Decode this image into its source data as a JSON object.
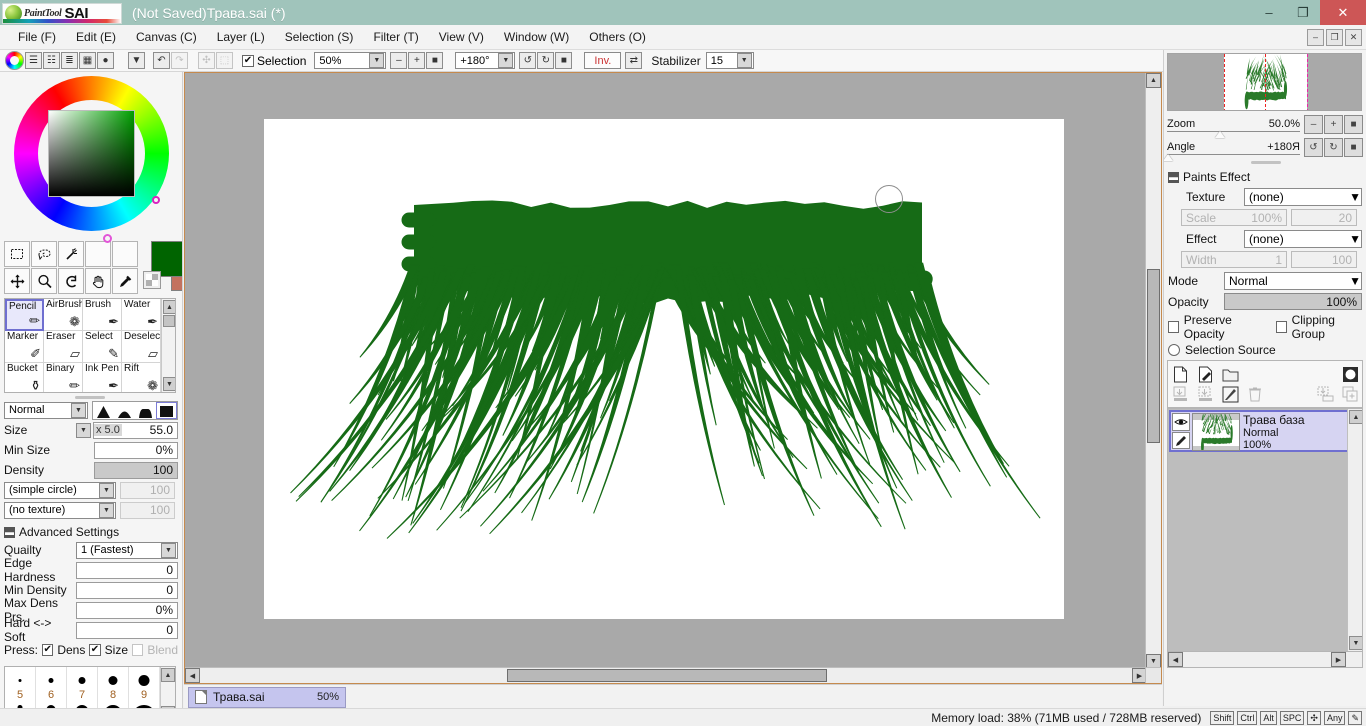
{
  "app": {
    "brand_paint_tool": "PaintTool",
    "brand_sai": "SAI",
    "title": "(Not Saved)Трава.sai (*)"
  },
  "window_controls": {
    "minimize": "–",
    "maximize": "❐",
    "close": "✕"
  },
  "menu": {
    "items": [
      {
        "label": "File (F)"
      },
      {
        "label": "Edit (E)"
      },
      {
        "label": "Canvas (C)"
      },
      {
        "label": "Layer (L)"
      },
      {
        "label": "Selection (S)"
      },
      {
        "label": "Filter (T)"
      },
      {
        "label": "View (V)"
      },
      {
        "label": "Window (W)"
      },
      {
        "label": "Others (O)"
      }
    ],
    "win_minimize": "–",
    "win_restore": "❐",
    "win_close": "✕"
  },
  "toolbar": {
    "palette_icons": [
      "color-wheel-icon",
      "rgb-slider-icon",
      "hsv-slider-icon",
      "color-list-icon",
      "swatches-icon",
      "gradient-icon"
    ],
    "more_arrow": "▼",
    "undo": "↶",
    "redo": "↷",
    "transform": "✣",
    "crop": "⬚",
    "selection_label": "Selection",
    "selection_checked": "✔",
    "zoom_value": "50%",
    "zoom_out": "–",
    "zoom_in": "+",
    "zoom_reset": "■",
    "angle_value": "+180°",
    "rotate_ccw": "↺",
    "rotate_cw": "↻",
    "rotate_reset": "■",
    "invert_label": "Inv.",
    "flip_label": "⇄",
    "stabilizer_label": "Stabilizer",
    "stabilizer_value": "15",
    "dropdown_arrow": "▼"
  },
  "left_panel": {
    "tool_icons_row1": [
      "rect-select-icon",
      "lasso-select-icon",
      "magic-wand-icon",
      "empty-slot-icon",
      "empty-slot-icon"
    ],
    "tool_icons_row2": [
      "move-icon",
      "zoom-icon",
      "rotate-icon",
      "hand-icon",
      "eyedropper-icon"
    ],
    "tool_glyphs_row1": [
      "⬚",
      "◖",
      "✳",
      "",
      ""
    ],
    "tool_glyphs_row2": [
      "✥",
      "⚲",
      "↺",
      "✋",
      "✒"
    ],
    "foreground_color": "#006400",
    "background_color": "#c3725f",
    "swap_glyph": "⬌",
    "brushes": [
      {
        "label": "Pencil",
        "glyph": "✏",
        "selected": true
      },
      {
        "label": "AirBrush",
        "glyph": "❁",
        "selected": false
      },
      {
        "label": "Brush",
        "glyph": "✒",
        "selected": false
      },
      {
        "label": "Water",
        "glyph": "✒",
        "selected": false
      },
      {
        "label": "Marker",
        "glyph": "✐",
        "selected": false
      },
      {
        "label": "Eraser",
        "glyph": "▱",
        "selected": false
      },
      {
        "label": "Select",
        "glyph": "✎",
        "selected": false
      },
      {
        "label": "Deselect",
        "glyph": "▱",
        "selected": false
      },
      {
        "label": "Bucket",
        "glyph": "⚱",
        "selected": false
      },
      {
        "label": "Binary",
        "glyph": "✏",
        "selected": false
      },
      {
        "label": "Ink Pen",
        "glyph": "✒",
        "selected": false
      },
      {
        "label": "Rift",
        "glyph": "❁",
        "selected": false
      }
    ],
    "blend_mode": "Normal",
    "size_label": "Size",
    "size_multiplier": "x 5.0",
    "size_value": "55.0",
    "min_size_label": "Min Size",
    "min_size_value": "0%",
    "density_label": "Density",
    "density_value": "100",
    "shape_label": "(simple circle)",
    "shape_value": "100",
    "texture_label": "(no texture)",
    "texture_value": "100",
    "advanced_label": "Advanced Settings",
    "quality_label": "Quailty",
    "quality_value": "1 (Fastest)",
    "edge_hardness_label": "Edge Hardness",
    "edge_hardness_value": "0",
    "min_density_label": "Min Density",
    "min_density_value": "0",
    "max_dens_prs_label": "Max Dens Prs.",
    "max_dens_prs_value": "0%",
    "hard_soft_label": "Hard <-> Soft",
    "hard_soft_value": "0",
    "press_label": "Press:",
    "press_dens": "Dens",
    "press_size": "Size",
    "press_blend": "Blend",
    "size_presets": [
      "5",
      "6",
      "7",
      "8",
      "9"
    ]
  },
  "canvas": {
    "page_color": "#ffffff",
    "background_color": "#a9a9a9",
    "grass_color": "#166b16",
    "brush_cursor": "brush-cursor-circle"
  },
  "doc_tab": {
    "filename": "Трава.sai",
    "zoom": "50%"
  },
  "right_panel": {
    "navigator": {
      "zoom_label": "Zoom",
      "zoom_value": "50.0%",
      "angle_label": "Angle",
      "angle_value": "+180Я",
      "zoom_out": "–",
      "zoom_in": "+",
      "zoom_reset": "■",
      "rotate_ccw": "↺",
      "rotate_cw": "↻",
      "rotate_reset": "■"
    },
    "paints_effect": {
      "title": "Paints Effect",
      "texture_label": "Texture",
      "texture_value": "(none)",
      "scale_label": "Scale",
      "scale_value": "100%",
      "scale_second": "20",
      "effect_label": "Effect",
      "effect_value": "(none)",
      "width_label": "Width",
      "width_value": "1",
      "width_second": "100"
    },
    "layer_props": {
      "mode_label": "Mode",
      "mode_value": "Normal",
      "opacity_label": "Opacity",
      "opacity_value": "100%",
      "preserve_opacity": "Preserve Opacity",
      "clipping_group": "Clipping Group",
      "selection_source": "Selection Source"
    },
    "layer_toolbar": {
      "row1": [
        "new-layer-icon",
        "new-linework-layer-icon",
        "new-folder-icon",
        "layer-mask-icon"
      ],
      "row1_glyphs": [
        "⬜",
        "✐",
        "▱",
        "●"
      ],
      "row2": [
        "merge-down-icon",
        "merge-selected-icon",
        "clear-layer-icon",
        "delete-layer-icon",
        "transfer-icon",
        "duplicate-icon"
      ],
      "row2_glyphs": [
        "⬇",
        "⬇",
        "◈",
        "Ὕ1",
        "⬇",
        "⧉"
      ]
    },
    "layers": [
      {
        "name": "Трава база",
        "mode": "Normal",
        "opacity": "100%",
        "visible_icon": "eye-icon",
        "lock_icon": "pen-icon",
        "selected": true
      }
    ]
  },
  "status_bar": {
    "memory": "Memory load: 38% (71MB used / 728MB reserved)",
    "keys": [
      "Shift",
      "Ctrl",
      "Alt",
      "SPC",
      "✣",
      "Any",
      "✎"
    ]
  }
}
